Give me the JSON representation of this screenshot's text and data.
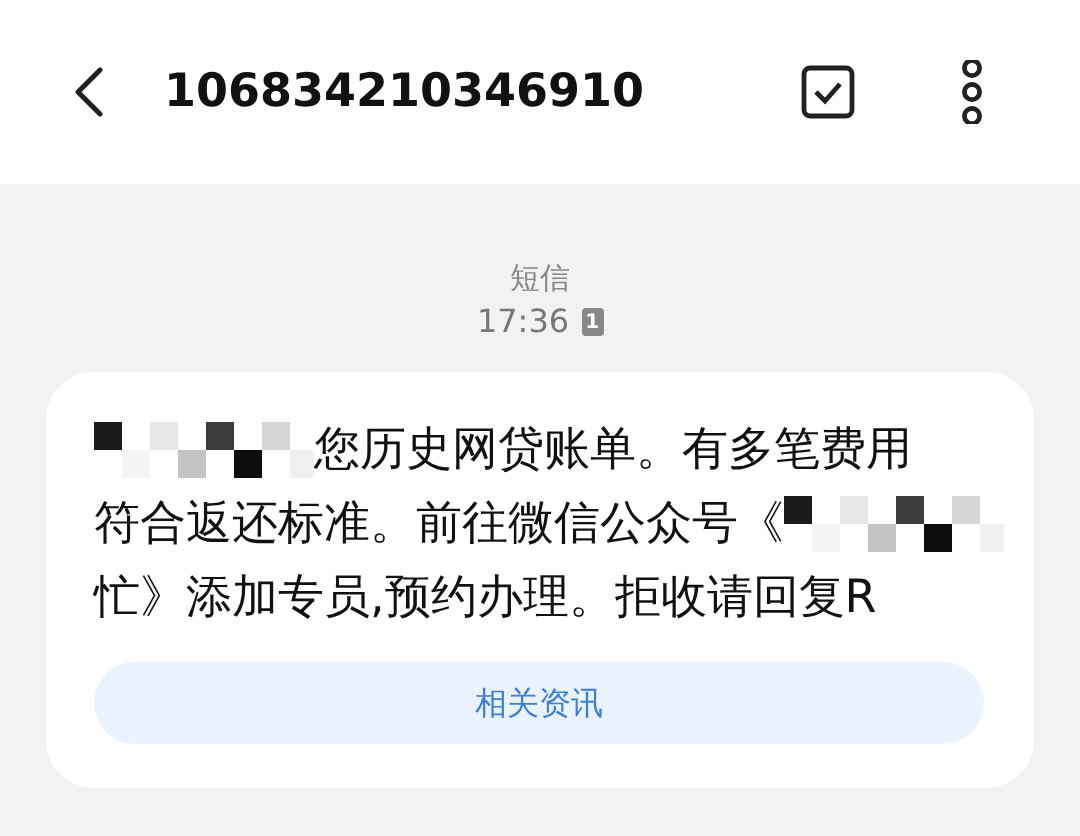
{
  "header": {
    "title": "106834210346910"
  },
  "meta": {
    "label": "短信",
    "time": "17:36",
    "sim": "1"
  },
  "message": {
    "lines": [
      [
        {
          "kind": "redacted"
        },
        {
          "kind": "text",
          "text": "您历史网贷账单。有多笔费用"
        }
      ],
      [
        {
          "kind": "text",
          "text": "符合返还标准。前往微信公众号《"
        },
        {
          "kind": "redacted"
        }
      ],
      [
        {
          "kind": "text",
          "text": "忙》添加专员,预约办理。拒收请回复R"
        }
      ]
    ]
  },
  "button": {
    "label": "相关资讯"
  }
}
